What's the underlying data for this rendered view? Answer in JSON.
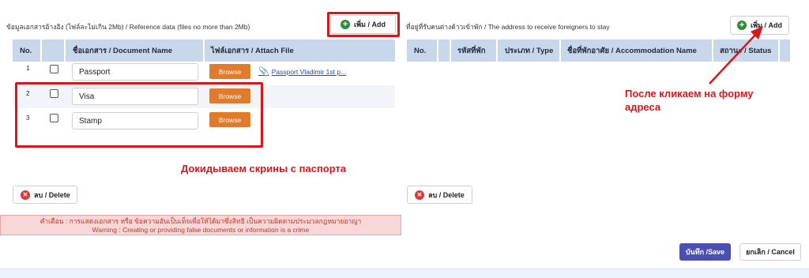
{
  "documents": {
    "title": "ข้อมูลเอกสารอ้างอิง (ไฟล์ละไม่เกิน 2Mb) / Reference data (files no more than 2Mb)",
    "add_label": "เพิ่ม / Add",
    "headers": {
      "no": "No.",
      "select": "",
      "doc_name": "ชื่อเอกสาร / Document Name",
      "attach": "ไฟล์เอกสาร / Attach File"
    },
    "rows": [
      {
        "no": "1",
        "name": "Passport",
        "browse": "Browse",
        "attached_file": "Passport Vladimir 1st p..."
      },
      {
        "no": "2",
        "name": "Visa",
        "browse": "Browse",
        "attached_file": ""
      },
      {
        "no": "3",
        "name": "Stamp",
        "browse": "Browse",
        "attached_file": ""
      }
    ],
    "delete_label": "ลบ / Delete",
    "annotation": "Докидываем скрины с паспорта"
  },
  "address": {
    "title": "ที่อยู่ที่รับคนต่างด้าวเข้าพัก / The address to receive foreigners to stay",
    "add_label": "เพิ่ม / Add",
    "headers": {
      "no": "No.",
      "select": "",
      "code": "รหัสที่พัก",
      "type": "ประเภท / Type",
      "acc_name": "ชื่อที่พักอาศัย / Accommodation Name",
      "status": "สถานะ / Status"
    },
    "delete_label": "ลบ / Delete",
    "annotation_line1": "После кликаем на форму",
    "annotation_line2": "адреса"
  },
  "warning": {
    "line1": "คำเตือน : การแสดงเอกสาร หรือ ข้อความอันเป็นเท็จเพื่อให้ได้มาซึ่งสิทธิ เป็นความผิดตามประมวลกฎหมายอาญา",
    "line2": "Warning : Creating or providing false documents or information is a crime"
  },
  "actions": {
    "save_label": "บันทึก /Save",
    "cancel_label": "ยกเลิก / Cancel"
  },
  "colors": {
    "annotation_red": "#d8151b",
    "table_header": "#c9d7ea",
    "browse_orange": "#e07b2e",
    "save_blue": "#4b4fb0",
    "add_green": "#2e8b3a",
    "delete_red": "#d83a3a"
  },
  "icons": {
    "add": "plus-circle-icon",
    "delete": "x-circle-icon",
    "attach": "paperclip-icon",
    "arrow": "red-arrow-icon"
  }
}
